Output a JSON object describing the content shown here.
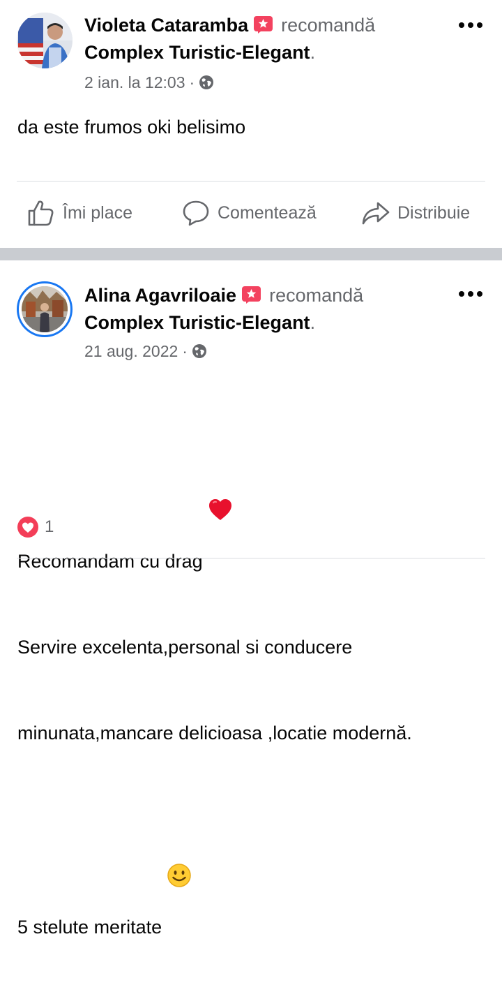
{
  "posts": [
    {
      "author": "Violeta Cataramba",
      "action": "recomandă",
      "page": "Complex Turistic-Elegant",
      "page_suffix": ".",
      "timestamp": "2 ian. la 12:03",
      "separator": "·",
      "privacy_icon": "globe-icon",
      "recommend_icon": "recommend-badge-icon",
      "more_icon": "more-options-icon",
      "text": "da este frumos oki belisimo",
      "actions": {
        "like": "Îmi place",
        "comment": "Comentează",
        "share": "Distribuie"
      }
    },
    {
      "author": "Alina Agavriloaie",
      "action": "recomandă",
      "page": "Complex Turistic-Elegant",
      "page_suffix": ".",
      "timestamp": "21 aug. 2022",
      "separator": "·",
      "privacy_icon": "globe-icon",
      "recommend_icon": "recommend-badge-icon",
      "more_icon": "more-options-icon",
      "lines": [
        "Recomandam cu drag",
        "Servire excelenta,personal si conducere",
        "minunata,mancare delicioasa ,locatie modernă.",
        "5 stelute meritate"
      ],
      "line_emojis": [
        "heart-emoji",
        "smile-emoji"
      ],
      "reactions": {
        "icon": "love-reaction-icon",
        "count": "1"
      }
    }
  ],
  "colors": {
    "text": "#050505",
    "secondary": "#65676b",
    "accent": "#1877f2",
    "separator": "#c9ccd1",
    "badge": "#f3425f"
  }
}
